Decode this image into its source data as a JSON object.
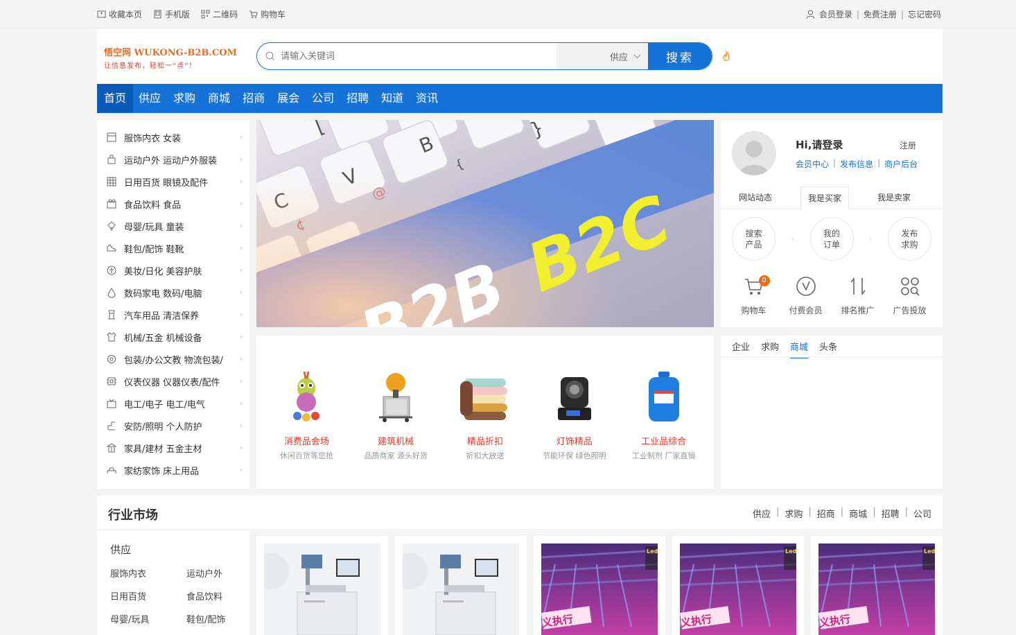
{
  "topbar": {
    "left": [
      {
        "icon": "bookmark-icon",
        "label": "收藏本页"
      },
      {
        "icon": "mobile-icon",
        "label": "手机版"
      },
      {
        "icon": "qrcode-icon",
        "label": "二维码"
      },
      {
        "icon": "cart-icon",
        "label": "购物车"
      }
    ],
    "right": {
      "login": "会员登录",
      "register": "免费注册",
      "forgot": "忘记密码"
    }
  },
  "logo": {
    "line1_cn": "悟空网",
    "line1_en": "WUKONG-B2B.COM",
    "line2": "让信息发布，轻松一“点”！"
  },
  "search": {
    "placeholder": "请输入关键词",
    "category": "供应",
    "button": "搜索"
  },
  "nav": [
    "首页",
    "供应",
    "求购",
    "商城",
    "招商",
    "展会",
    "公司",
    "招聘",
    "知道",
    "资讯"
  ],
  "categories": [
    {
      "icon": "clothing-icon",
      "label": "服饰内衣 女装"
    },
    {
      "icon": "sports-icon",
      "label": "运动户外 运动户外服装"
    },
    {
      "icon": "grid-icon",
      "label": "日用百货 眼镜及配件"
    },
    {
      "icon": "food-icon",
      "label": "食品饮料 食品"
    },
    {
      "icon": "bulb-icon",
      "label": "母婴/玩具 童装"
    },
    {
      "icon": "shoe-icon",
      "label": "鞋包/配饰 鞋靴"
    },
    {
      "icon": "cosmetics-icon",
      "label": "美妆/日化 美容护肤"
    },
    {
      "icon": "drop-icon",
      "label": "数码家电 数码/电脑"
    },
    {
      "icon": "car-icon",
      "label": "汽车用品 清洁保养"
    },
    {
      "icon": "shirt-icon",
      "label": "机械/五金 机械设备"
    },
    {
      "icon": "gear-icon",
      "label": "包装/办公文教 物流包装/"
    },
    {
      "icon": "chip-icon",
      "label": "仪表仪器 仪器仪表/配件"
    },
    {
      "icon": "tv-icon",
      "label": "电工/电子 电工/电气"
    },
    {
      "icon": "shield-icon",
      "label": "安防/照明 个人防护"
    },
    {
      "icon": "bank-icon",
      "label": "家具/建材 五金主材"
    },
    {
      "icon": "bed-icon",
      "label": "家纺家饰 床上用品"
    }
  ],
  "banner": {
    "text_a": "B2B",
    "text_b": "B2C"
  },
  "user": {
    "greeting": "Hi,请登录",
    "register": "注册",
    "links": [
      "会员中心",
      "发布信息",
      "商户后台"
    ],
    "tabs": [
      "网站动态",
      "我是买家",
      "我是卖家"
    ],
    "active_tab": 1,
    "circles": [
      [
        "搜索",
        "产品"
      ],
      [
        "我的",
        "订单"
      ],
      [
        "发布",
        "求购"
      ]
    ],
    "tools": [
      {
        "icon": "cart-icon",
        "label": "购物车",
        "badge": "0"
      },
      {
        "icon": "vip-icon",
        "label": "付费会员"
      },
      {
        "icon": "rank-icon",
        "label": "排名推广"
      },
      {
        "icon": "ad-icon",
        "label": "广告投放"
      }
    ]
  },
  "featured": [
    {
      "icon": "toy-giraffe-icon",
      "title": "消费品会场",
      "sub": "休闲百货等您抢"
    },
    {
      "icon": "fog-cannon-icon",
      "title": "建筑机械",
      "sub": "品质商家 源头好货"
    },
    {
      "icon": "towel-stack-icon",
      "title": "精品折扣",
      "sub": "折扣大放送"
    },
    {
      "icon": "stage-light-icon",
      "title": "灯饰精品",
      "sub": "节能环保 绿色照明"
    },
    {
      "icon": "barrel-icon",
      "title": "工业品综合",
      "sub": "工业制剂 厂家直销"
    }
  ],
  "news": {
    "tabs": [
      "企业",
      "求购",
      "商城",
      "头条"
    ],
    "active": 2
  },
  "industry": {
    "title": "行业市场",
    "links": [
      "供应",
      "求购",
      "招商",
      "商城",
      "招聘",
      "公司"
    ],
    "side_title": "供应",
    "side_items": [
      "服饰内衣",
      "运动户外",
      "日用百货",
      "食品饮料",
      "母婴/玩具",
      "鞋包/配饰"
    ]
  },
  "products": [
    {
      "type": "laser-machine",
      "label": ""
    },
    {
      "type": "laser-machine",
      "label": ""
    },
    {
      "type": "stage-lights",
      "label": "义执行"
    },
    {
      "type": "stage-lights",
      "label": "义执行"
    },
    {
      "type": "stage-lights",
      "label": "义执行"
    }
  ],
  "colors": {
    "primary": "#1572d8",
    "accent": "#e23a2e",
    "orange": "#f26a11"
  }
}
